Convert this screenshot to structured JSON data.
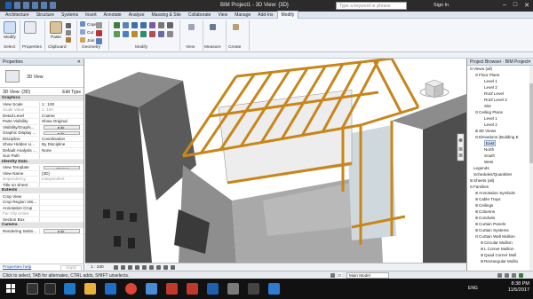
{
  "titlebar": {
    "title": "BIM Project1 - 3D View: {3D}",
    "search_placeholder": "Type a keyword or phrase",
    "signin": "Sign In"
  },
  "tabs": [
    "Architecture",
    "Structure",
    "Systems",
    "Insert",
    "Annotate",
    "Analyze",
    "Massing & Site",
    "Collaborate",
    "View",
    "Manage",
    "Add-Ins",
    "Modify"
  ],
  "ribbon": {
    "modify": "Modify",
    "select": "Select",
    "properties": "Properties",
    "clipboard": "Clipboard",
    "cope": "Cope",
    "cut": "Cut",
    "join": "Join",
    "geometry": "Geometry",
    "paste": "Paste",
    "group_modify": "Modify",
    "view": "View",
    "measure": "Measure",
    "create": "Create"
  },
  "properties": {
    "title": "Properties",
    "type_name": "3D View",
    "selector": "3D View: {3D}",
    "edit_type": "Edit Type",
    "groups": [
      {
        "name": "Graphics",
        "rows": [
          {
            "k": "View Scale",
            "v": "1 : 100"
          },
          {
            "k": "Scale Value",
            "v": "1:  100",
            "grey": true
          },
          {
            "k": "Detail Level",
            "v": "Coarse"
          },
          {
            "k": "Parts Visibility",
            "v": "Show Original"
          },
          {
            "k": "Visibility/Graphi...",
            "v": "Edit...",
            "btn": true
          },
          {
            "k": "Graphic Display ...",
            "v": "Edit...",
            "btn": true
          },
          {
            "k": "Discipline",
            "v": "Coordination"
          },
          {
            "k": "Show Hidden Li...",
            "v": "By Discipline"
          },
          {
            "k": "Default Analysis ...",
            "v": "None"
          },
          {
            "k": "Sun Path",
            "v": ""
          }
        ]
      },
      {
        "name": "Identity Data",
        "rows": [
          {
            "k": "View Template",
            "v": "<None>",
            "btn": true
          },
          {
            "k": "View Name",
            "v": "{3D}"
          },
          {
            "k": "Dependency",
            "v": "Independent",
            "grey": true
          },
          {
            "k": "Title on Sheet",
            "v": ""
          }
        ]
      },
      {
        "name": "Extents",
        "rows": [
          {
            "k": "Crop View",
            "v": ""
          },
          {
            "k": "Crop Region Visi...",
            "v": ""
          },
          {
            "k": "Annotation Crop",
            "v": ""
          },
          {
            "k": "Far Clip Active",
            "v": "",
            "grey": true
          },
          {
            "k": "Section Box",
            "v": ""
          }
        ]
      },
      {
        "name": "Camera",
        "rows": [
          {
            "k": "Rendering Settin...",
            "v": "Edit...",
            "btn": true
          }
        ]
      }
    ],
    "help_link": "Properties help",
    "apply": "Apply"
  },
  "viewbar": {
    "scale": "1 : 100"
  },
  "browser": {
    "title": "Project Browser - BIM Project1",
    "items": [
      {
        "t": "Views (all)",
        "l": 0,
        "tw": "⊟"
      },
      {
        "t": "Floor Plans",
        "l": 1,
        "tw": "⊟"
      },
      {
        "t": "Level 1",
        "l": 2,
        "tw": ""
      },
      {
        "t": "Level 2",
        "l": 2,
        "tw": ""
      },
      {
        "t": "Roof Level",
        "l": 2,
        "tw": ""
      },
      {
        "t": "Roof Level 2",
        "l": 2,
        "tw": ""
      },
      {
        "t": "Site",
        "l": 2,
        "tw": ""
      },
      {
        "t": "Ceiling Plans",
        "l": 1,
        "tw": "⊟"
      },
      {
        "t": "Level 1",
        "l": 2,
        "tw": ""
      },
      {
        "t": "Level 2",
        "l": 2,
        "tw": ""
      },
      {
        "t": "3D Views",
        "l": 1,
        "tw": "⊞"
      },
      {
        "t": "Elevations (Building E",
        "l": 1,
        "tw": "⊟"
      },
      {
        "t": "East",
        "l": 2,
        "tw": "",
        "sel": true
      },
      {
        "t": "North",
        "l": 2,
        "tw": ""
      },
      {
        "t": "South",
        "l": 2,
        "tw": ""
      },
      {
        "t": "West",
        "l": 2,
        "tw": ""
      },
      {
        "t": "Legends",
        "l": 0,
        "tw": ""
      },
      {
        "t": "Schedules/Quantities",
        "l": 0,
        "tw": ""
      },
      {
        "t": "Sheets (all)",
        "l": 0,
        "tw": "⊞"
      },
      {
        "t": "Families",
        "l": 0,
        "tw": "⊟"
      },
      {
        "t": "Annotation Symbols",
        "l": 1,
        "tw": "⊞"
      },
      {
        "t": "Cable Trays",
        "l": 1,
        "tw": "⊞"
      },
      {
        "t": "Ceilings",
        "l": 1,
        "tw": "⊞"
      },
      {
        "t": "Columns",
        "l": 1,
        "tw": "⊞"
      },
      {
        "t": "Conduits",
        "l": 1,
        "tw": "⊞"
      },
      {
        "t": "Curtain Panels",
        "l": 1,
        "tw": "⊞"
      },
      {
        "t": "Curtain Systems",
        "l": 1,
        "tw": "⊞"
      },
      {
        "t": "Curtain Wall Mullion",
        "l": 1,
        "tw": "⊟"
      },
      {
        "t": "Circular Mullion",
        "l": 2,
        "tw": "⊞"
      },
      {
        "t": "L Corner Mullion",
        "l": 2,
        "tw": "⊞"
      },
      {
        "t": "Quad Corner Mull",
        "l": 2,
        "tw": "⊞"
      },
      {
        "t": "Rectangular Mullio",
        "l": 2,
        "tw": "⊞"
      }
    ]
  },
  "statusbar": {
    "text": "Click to select, TAB for alternates, CTRL adds, SHIFT unselects.",
    "model": "Main Model",
    "coord": ":0"
  },
  "taskbar": {
    "lang": "ENG",
    "time": "8:38 PM",
    "date": "11/5/2017"
  },
  "colors": {
    "timber": "#c8861a",
    "titlebar": "#2b2b2b",
    "ribbon": "#f4f6fa",
    "accent": "#1f5fae"
  }
}
